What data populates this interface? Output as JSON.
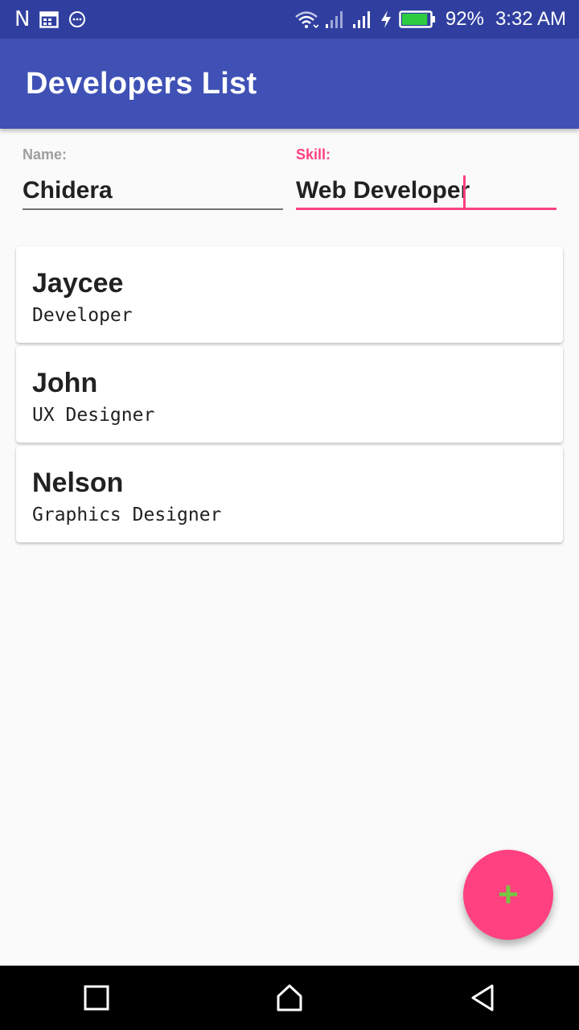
{
  "status_bar": {
    "carrier_icon": "N",
    "battery_percent": "92%",
    "time": "3:32 AM",
    "icons": [
      "notification-n-icon",
      "calendar-icon",
      "chat-bubble-icon",
      "wifi-icon",
      "signal-icon",
      "charging-icon",
      "battery-icon"
    ],
    "battery_level": 0.92,
    "battery_color": "#2ecc40"
  },
  "app_bar": {
    "title": "Developers List",
    "color": "#3f51b5"
  },
  "form": {
    "name_label": "Name:",
    "name_value": "Chidera",
    "skill_label": "Skill:",
    "skill_value": "Web Developer",
    "accent_color": "#ff4081"
  },
  "developers": [
    {
      "name": "Jaycee",
      "skill": "Developer"
    },
    {
      "name": "John",
      "skill": "UX Designer"
    },
    {
      "name": "Nelson",
      "skill": "Graphics Designer"
    }
  ],
  "fab": {
    "label": "+",
    "icon": "plus-icon",
    "color": "#ff4081"
  },
  "nav_bar": {
    "buttons": [
      "recents-square-icon",
      "home-icon",
      "back-triangle-icon"
    ]
  }
}
